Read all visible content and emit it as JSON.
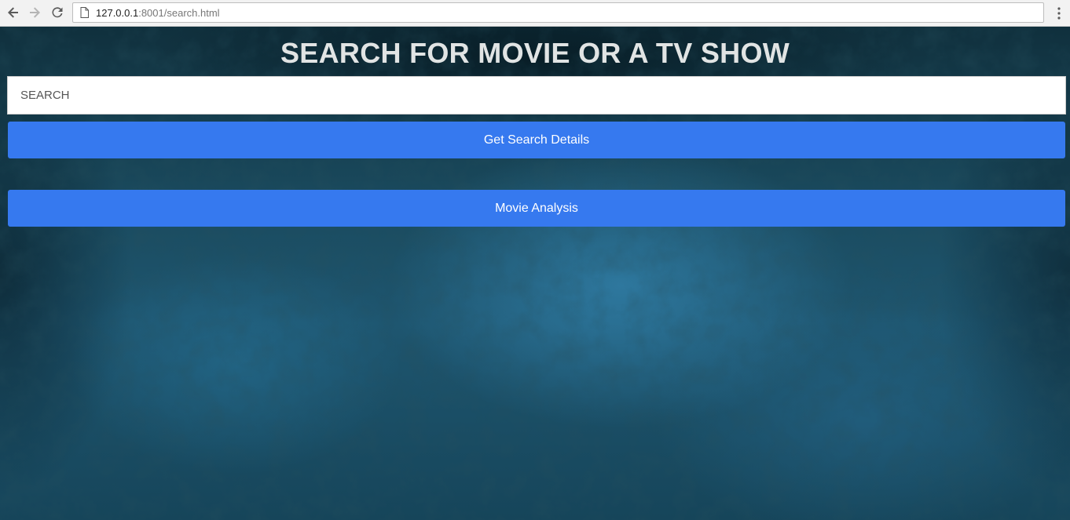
{
  "browser": {
    "url_host": "127.0.0.1",
    "url_rest": ":8001/search.html",
    "icons": {
      "back": "arrow-left-icon",
      "forward": "arrow-right-icon",
      "reload": "reload-icon",
      "page": "page-icon",
      "menu": "more-vert-icon"
    }
  },
  "page": {
    "title": "SEARCH FOR MOVIE OR A TV SHOW",
    "search": {
      "placeholder": "SEARCH",
      "value": ""
    },
    "buttons": {
      "search_details": "Get Search Details",
      "movie_analysis": "Movie Analysis"
    }
  },
  "colors": {
    "button": "#3679ef",
    "title_text": "#e1e4e4",
    "background": "#1a4a5e"
  }
}
